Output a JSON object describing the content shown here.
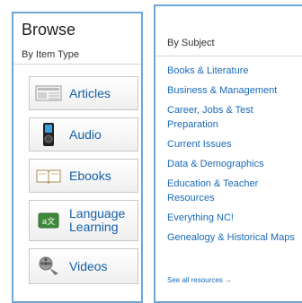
{
  "browse": {
    "title": "Browse",
    "subtitle": "By Item Type",
    "items": [
      {
        "label": "Articles",
        "icon": "newspaper-icon"
      },
      {
        "label": "Audio",
        "icon": "media-player-icon"
      },
      {
        "label": "Ebooks",
        "icon": "open-book-icon"
      },
      {
        "label": "Language Learning",
        "icon": "language-icon"
      },
      {
        "label": "Videos",
        "icon": "film-reel-icon"
      }
    ]
  },
  "subjects": {
    "title": "By Subject",
    "items": [
      "Books & Literature",
      "Business & Management",
      "Career, Jobs & Test Preparation",
      "Current Issues",
      "Data & Demographics",
      "Education & Teacher Resources",
      "Everything NC!",
      "Genealogy & Historical Maps"
    ],
    "see_all": "See all resources →"
  },
  "colors": {
    "border": "#6fa6d8",
    "link": "#1a6ab8"
  }
}
